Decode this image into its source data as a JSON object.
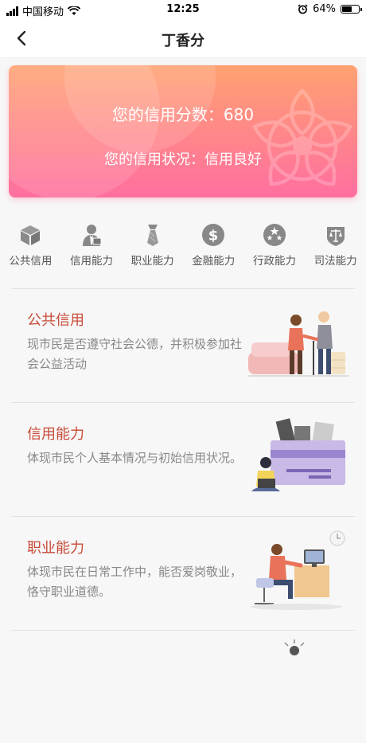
{
  "status_bar": {
    "carrier": "中国移动",
    "time": "12:25",
    "battery": "64%",
    "battery_level": 0.64
  },
  "nav": {
    "title": "丁香分"
  },
  "score_card": {
    "score_text": "您的信用分数：680",
    "status_text": "您的信用状况：信用良好"
  },
  "categories": [
    {
      "label": "公共信用",
      "icon": "cube-icon"
    },
    {
      "label": "信用能力",
      "icon": "person-suit-icon"
    },
    {
      "label": "职业能力",
      "icon": "tie-icon"
    },
    {
      "label": "金融能力",
      "icon": "dollar-icon"
    },
    {
      "label": "行政能力",
      "icon": "stars-icon"
    },
    {
      "label": "司法能力",
      "icon": "scales-icon"
    }
  ],
  "items": [
    {
      "title": "公共信用",
      "desc": "现市民是否遵守社会公德，并积极参加社会公益活动",
      "illustration": "helping-elder-illustration"
    },
    {
      "title": "信用能力",
      "desc": "体现市民个人基本情况与初始信用状况。",
      "illustration": "credit-card-illustration"
    },
    {
      "title": "职业能力",
      "desc": "体现市民在日常工作中，能否爱岗敬业，恪守职业道德。",
      "illustration": "office-worker-illustration"
    }
  ],
  "colors": {
    "accent_title": "#c84a38",
    "card_gradient_top": "#ffa271",
    "card_gradient_bottom": "#ff6fa0"
  }
}
